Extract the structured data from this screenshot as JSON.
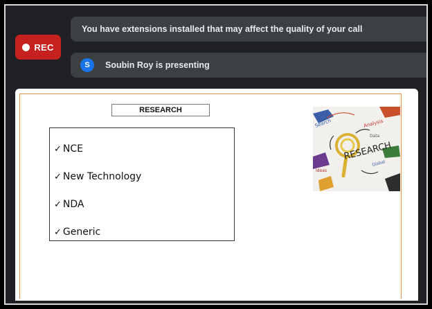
{
  "recording": {
    "label": "REC"
  },
  "notifications": {
    "extensions_text": "You have extensions installed that may affect the quality of your call",
    "presenter_initial": "S",
    "presenting_text": "Soubin Roy is presenting"
  },
  "slide": {
    "title": "RESEARCH",
    "bullets": [
      "NCE",
      "New Technology",
      "NDA",
      "Generic"
    ],
    "image_text": "RESEARCH"
  },
  "colors": {
    "rec_badge": "#c5221f",
    "banner": "#3c4043",
    "background": "#202124",
    "avatar": "#1a73e8",
    "slide_border": "#e0904a"
  }
}
